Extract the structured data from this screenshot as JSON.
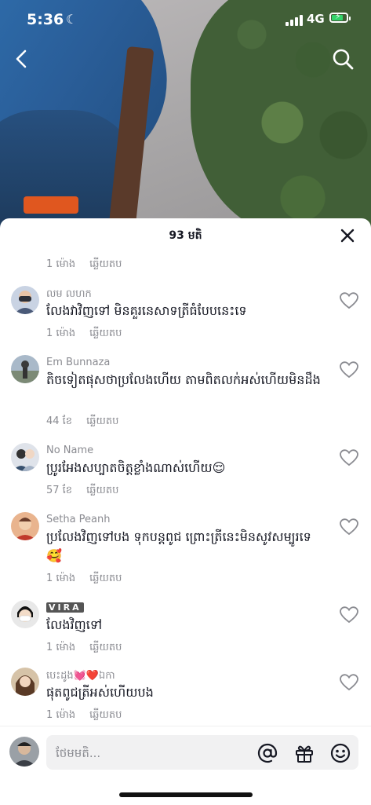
{
  "status_bar": {
    "time": "5:36",
    "network": "4G"
  },
  "sheet": {
    "title": "93 មតិ"
  },
  "meta_labels": {
    "reply": "ឆ្លើយតប"
  },
  "first_meta_time": "1 ម៉ោង",
  "comments": [
    {
      "name": "លម លហក",
      "text": "លែងវាវិញទៅ មិនគួរនេសាទត្រីធំបែបនេះទេ",
      "time": "1 ម៉ោង"
    },
    {
      "name": "Em Bunnaza",
      "text": "តិចទៀតផុសថាប្រលែងហើយ តាមពិតលក់អស់ហើយមិនដឹង",
      "time": "44 ខែ"
    },
    {
      "name": "No Name",
      "text": "ប្រូរអែងសប្បាតចិត្តខ្លាំងណាស់ហើយ😌",
      "time": "57 ខែ"
    },
    {
      "name": "Setha Peanh",
      "text": "ប្រលែងវិញទៅបង ទុកបន្តពូជ ព្រោះត្រីនេះមិនសូវសម្បូរទេ🥰",
      "time": "1 ម៉ោង"
    },
    {
      "name": "VIRA",
      "text": "លែងវិញទៅ",
      "time": "1 ម៉ោង"
    },
    {
      "name": "បេះដូង💓❤️ឯកា",
      "text": "ផុតពូជត្រីអស់ហើយបង",
      "time": "1 ម៉ោង"
    }
  ],
  "input": {
    "placeholder": "ថែមមតិ..."
  },
  "icons": {
    "back": "back-arrow-icon",
    "search": "search-icon",
    "close": "close-icon",
    "heart": "heart-outline-icon",
    "at": "at-sign-icon",
    "gift": "gift-icon",
    "emoji": "smiley-icon"
  },
  "colors": {
    "text": "#161823",
    "muted": "#8a8b91",
    "input_bg": "#f1f1f2"
  }
}
